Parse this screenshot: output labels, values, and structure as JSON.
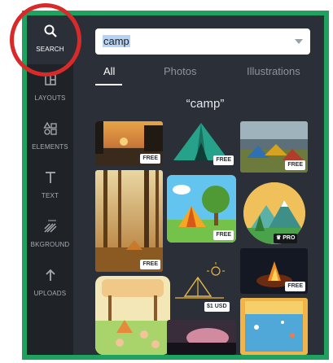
{
  "sidebar": {
    "items": [
      {
        "label": "SEARCH",
        "icon": "search-icon"
      },
      {
        "label": "LAYOUTS",
        "icon": "layouts-icon"
      },
      {
        "label": "ELEMENTS",
        "icon": "elements-icon"
      },
      {
        "label": "TEXT",
        "icon": "text-icon"
      },
      {
        "label": "BKGROUND",
        "icon": "background-icon"
      },
      {
        "label": "UPLOADS",
        "icon": "upload-icon"
      }
    ]
  },
  "search": {
    "value": "camp"
  },
  "tabs": [
    {
      "label": "All",
      "active": true
    },
    {
      "label": "Photos",
      "active": false
    },
    {
      "label": "Illustrations",
      "active": false
    }
  ],
  "results": {
    "query_label": "“camp”",
    "items": [
      {
        "badge": "FREE"
      },
      {
        "badge": "FREE"
      },
      {
        "badge": "FREE"
      },
      {
        "badge": "FREE"
      },
      {
        "badge": "FREE"
      },
      {
        "badge": "PRO"
      },
      {
        "badge": "FREE"
      },
      {
        "badge": "$1 USD"
      },
      {
        "badge": "FREE"
      }
    ]
  },
  "colors": {
    "sidebar_bg": "#1f2227",
    "panel_bg": "#2b3038",
    "frame_border": "#1fa25f",
    "highlight_circle": "#d92a2a"
  }
}
